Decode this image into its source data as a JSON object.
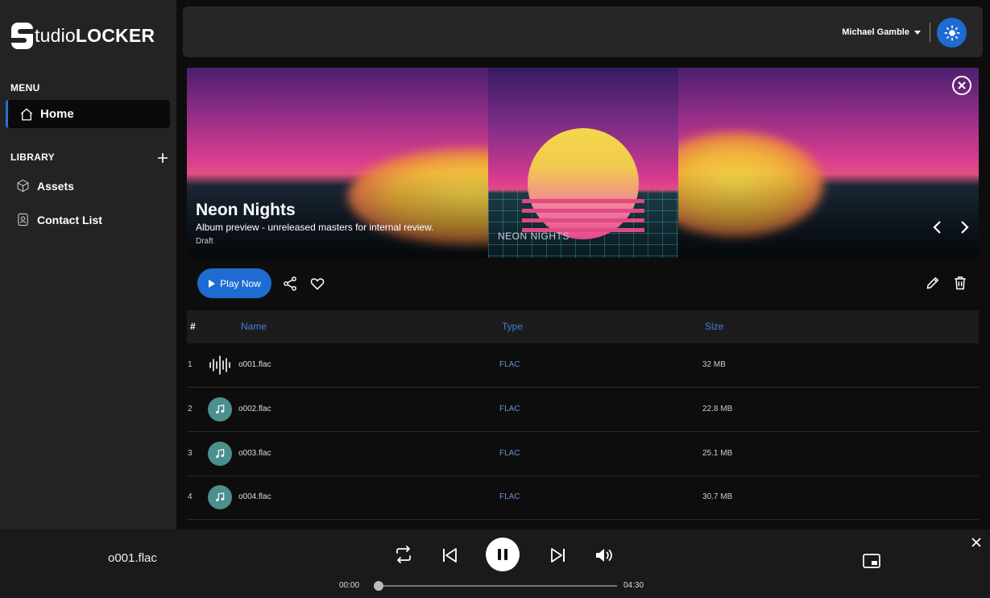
{
  "app": {
    "logo_prefix": "tudio",
    "logo_suffix": "LOCKER"
  },
  "sidebar": {
    "menu_label": "MENU",
    "library_label": "LIBRARY",
    "home_label": "Home",
    "items": [
      {
        "label": "Assets",
        "icon": "cube-icon"
      },
      {
        "label": "Contact List",
        "icon": "contact-book-icon"
      }
    ]
  },
  "header": {
    "user_name": "Michael Gamble",
    "theme_icon": "sun-icon"
  },
  "hero": {
    "title": "Neon Nights",
    "subtitle": "Album preview - unreleased masters for internal review.",
    "status": "Draft",
    "cover_text": "NEON NIGHTS"
  },
  "actions": {
    "play_label": "Play Now"
  },
  "table": {
    "columns": [
      "#",
      "Name",
      "Type",
      "Size"
    ],
    "rows": [
      {
        "num": "1",
        "name": "o001.flac",
        "type": "FLAC",
        "size": "32 MB",
        "playing": true
      },
      {
        "num": "2",
        "name": "o002.flac",
        "type": "FLAC",
        "size": "22.8 MB",
        "playing": false
      },
      {
        "num": "3",
        "name": "o003.flac",
        "type": "FLAC",
        "size": "25.1 MB",
        "playing": false
      },
      {
        "num": "4",
        "name": "o004.flac",
        "type": "FLAC",
        "size": "30.7 MB",
        "playing": false
      }
    ]
  },
  "player": {
    "now_playing": "o001.flac",
    "current_time": "00:00",
    "duration": "04:30",
    "progress": 0
  },
  "colors": {
    "accent": "#1e6cd2",
    "sidebar_bg": "#232323",
    "type_text": "#6b93d6",
    "thumb_bg": "#4c8f8f"
  }
}
